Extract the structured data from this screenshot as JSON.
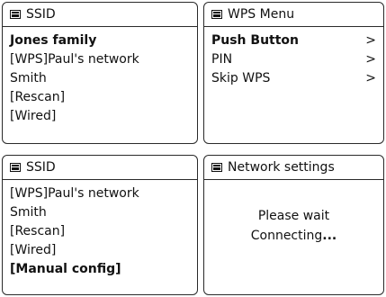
{
  "ssid_panel": {
    "title": "SSID",
    "items": [
      {
        "label": "Jones family",
        "selected": true
      },
      {
        "label": "[WPS]Paul's network",
        "selected": false
      },
      {
        "label": "Smith",
        "selected": false
      },
      {
        "label": "[Rescan]",
        "selected": false
      },
      {
        "label": "[Wired]",
        "selected": false
      }
    ]
  },
  "wps_menu": {
    "title": "WPS Menu",
    "items": [
      {
        "label": "Push Button",
        "chevron": ">",
        "selected": true
      },
      {
        "label": "PIN",
        "chevron": ">",
        "selected": false
      },
      {
        "label": "Skip WPS",
        "chevron": ">",
        "selected": false
      }
    ]
  },
  "ssid_panel_scrolled": {
    "title": "SSID",
    "items": [
      {
        "label": "[WPS]Paul's network",
        "selected": false
      },
      {
        "label": "Smith",
        "selected": false
      },
      {
        "label": "[Rescan]",
        "selected": false
      },
      {
        "label": "[Wired]",
        "selected": false
      },
      {
        "label": "[Manual config]",
        "selected": true
      }
    ]
  },
  "network_settings": {
    "title": "Network settings",
    "line1": "Please wait",
    "line2": "Connecting",
    "dots": "..."
  },
  "icon": "menu-icon"
}
